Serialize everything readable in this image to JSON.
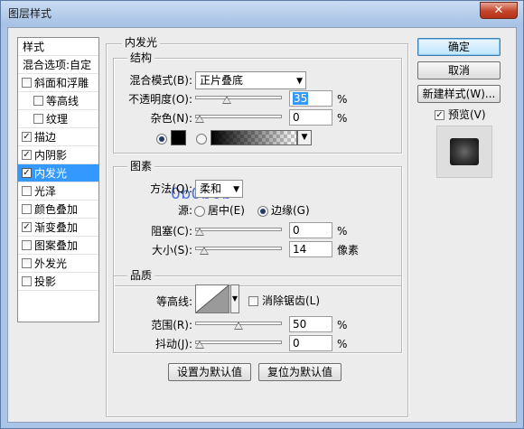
{
  "window": {
    "title": "图层样式",
    "close_glyph": "✕"
  },
  "sidebar": {
    "header": "样式",
    "blend_options": "混合选项:自定",
    "items": [
      {
        "label": "斜面和浮雕",
        "checked": false,
        "indent": false
      },
      {
        "label": "等高线",
        "checked": false,
        "indent": true
      },
      {
        "label": "纹理",
        "checked": false,
        "indent": true
      },
      {
        "label": "描边",
        "checked": true,
        "indent": false
      },
      {
        "label": "内阴影",
        "checked": true,
        "indent": false
      },
      {
        "label": "内发光",
        "checked": true,
        "indent": false,
        "selected": true
      },
      {
        "label": "光泽",
        "checked": false,
        "indent": false
      },
      {
        "label": "颜色叠加",
        "checked": false,
        "indent": false
      },
      {
        "label": "渐变叠加",
        "checked": true,
        "indent": false
      },
      {
        "label": "图案叠加",
        "checked": false,
        "indent": false
      },
      {
        "label": "外发光",
        "checked": false,
        "indent": false
      },
      {
        "label": "投影",
        "checked": false,
        "indent": false
      }
    ]
  },
  "inner_glow": {
    "title": "内发光",
    "structure": {
      "title": "结构",
      "blend_mode_label": "混合模式(B):",
      "blend_mode_value": "正片叠底",
      "opacity_label": "不透明度(O):",
      "opacity_value": "35",
      "opacity_fraction": 0.35,
      "opacity_unit": "%",
      "noise_label": "杂色(N):",
      "noise_value": "0",
      "noise_fraction": 0,
      "noise_unit": "%",
      "color_swatch": "#000000"
    },
    "elements": {
      "title": "图素",
      "annotation": "0b0b0b",
      "technique_label": "方法(Q):",
      "technique_value": "柔和",
      "source_label": "源:",
      "source_center": "居中(E)",
      "source_edge": "边缘(G)",
      "choke_label": "阻塞(C):",
      "choke_value": "0",
      "choke_fraction": 0,
      "choke_unit": "%",
      "size_label": "大小(S):",
      "size_value": "14",
      "size_fraction": 0.056,
      "size_unit": "像素"
    },
    "quality": {
      "title": "品质",
      "contour_label": "等高线:",
      "antialias_label": "消除锯齿(L)",
      "range_label": "范围(R):",
      "range_value": "50",
      "range_fraction": 0.5,
      "range_unit": "%",
      "jitter_label": "抖动(J):",
      "jitter_value": "0",
      "jitter_fraction": 0,
      "jitter_unit": "%"
    },
    "make_default": "设置为默认值",
    "reset_default": "复位为默认值"
  },
  "buttons": {
    "ok": "确定",
    "cancel": "取消",
    "new_style": "新建样式(W)...",
    "preview_label": "预览(V)",
    "preview_checked": true
  },
  "accent_color": "#3399ff"
}
